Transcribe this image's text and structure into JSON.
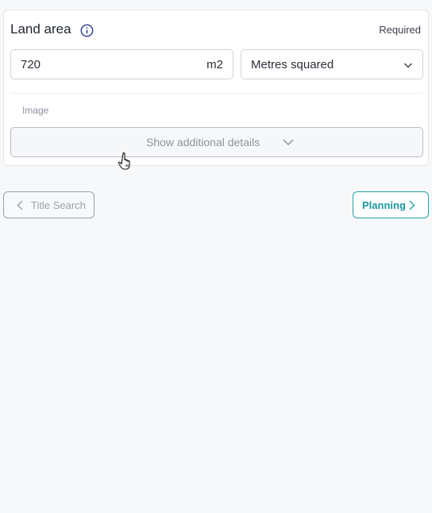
{
  "field": {
    "title": "Land area",
    "required_label": "Required",
    "info_icon": "info-circle-icon",
    "value": "720",
    "unit_suffix": "m2",
    "unit_select_value": "Metres squared"
  },
  "image_label": "Image",
  "details_button_label": "Show additional details",
  "nav": {
    "back_label": "Title Search",
    "next_label": "Planning"
  },
  "colors": {
    "accent": "#1fa3a8",
    "muted": "#9aa0aa",
    "info_icon": "#2b3a8f"
  }
}
